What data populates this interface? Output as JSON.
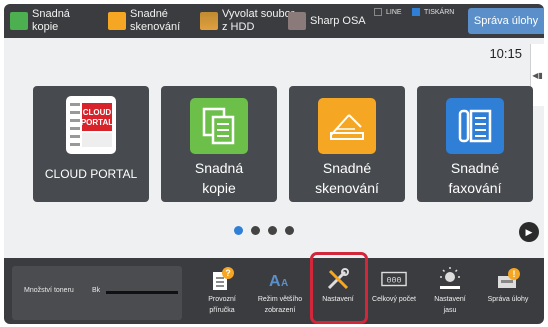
{
  "topbar": {
    "items": [
      {
        "label": "Snadná\nkopie",
        "icon": "copy-icon",
        "color": "#4caf50"
      },
      {
        "label": "Snadné\nskenování",
        "icon": "scan-icon",
        "color": "#f5a623"
      },
      {
        "label": "Vyvolat soubor\nz HDD",
        "icon": "hdd-folder-icon",
        "color": "#e0a040"
      },
      {
        "label": "Sharp OSA",
        "icon": "osa-icon",
        "color": "#888888"
      }
    ],
    "line_label": "LINE",
    "printer_label": "TISKÁRN",
    "job_status_button": "Správa úlohy"
  },
  "main": {
    "clock": "10:15",
    "tiles": [
      {
        "label": "CLOUD PORTAL",
        "icon": "cloud-portal-icon",
        "icon_text": "CLOUD\nPORTAL"
      },
      {
        "label": "Snadná\nkopie",
        "icon": "copy-icon",
        "color": "#6cc04a"
      },
      {
        "label": "Snadné\nskenování",
        "icon": "scan-icon",
        "color": "#f5a623"
      },
      {
        "label": "Snadné\nfaxování",
        "icon": "fax-icon",
        "color": "#2f7fd6"
      }
    ],
    "page_count": 4,
    "active_page": 1
  },
  "bottombar": {
    "toner_label": "Množství toneru",
    "toner_bk": "Bk",
    "shortcuts": [
      {
        "label": "Provozní\npříručka",
        "icon": "manual-icon"
      },
      {
        "label": "Režim většího\nzobrazení",
        "icon": "large-text-icon"
      },
      {
        "label": "Nastavení",
        "icon": "settings-tools-icon"
      },
      {
        "label": "Celkový počet",
        "icon": "counter-icon"
      },
      {
        "label": "Nastavení\njasu",
        "icon": "brightness-icon"
      },
      {
        "label": "Správa úlohy",
        "icon": "job-status-icon"
      }
    ]
  },
  "colors": {
    "bar": "#3a3c3f",
    "tile": "#474a4e",
    "accent": "#2f7fd6",
    "highlight": "#d2263b"
  }
}
